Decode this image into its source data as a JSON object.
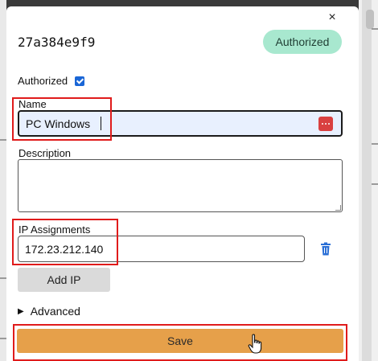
{
  "modal": {
    "close_glyph": "×",
    "node_id": "27a384e9f9",
    "status_badge": "Authorized"
  },
  "form": {
    "authorized_label": "Authorized",
    "authorized_checked": true,
    "name_label": "Name",
    "name_value": "PC Windows",
    "description_label": "Description",
    "description_value": "",
    "ip_label": "IP Assignments",
    "ip_value": "172.23.212.140",
    "add_ip_label": "Add IP",
    "advanced_label": "Advanced",
    "save_label": "Save"
  },
  "colors": {
    "status_badge_bg": "#a8e8cf",
    "save_button_bg": "#e6a04a",
    "name_input_bg": "#e8f0fe",
    "highlight_box": "#e01b1b",
    "trash_icon": "#2a6fd6",
    "password_manager_icon": "#d94040"
  },
  "icons": {
    "close": "close-icon",
    "checkbox": "checkbox-checked-icon",
    "password_manager": "password-manager-icon",
    "delete": "trash-icon",
    "disclosure": "triangle-right-icon",
    "cursor": "hand-pointer-cursor-icon"
  }
}
